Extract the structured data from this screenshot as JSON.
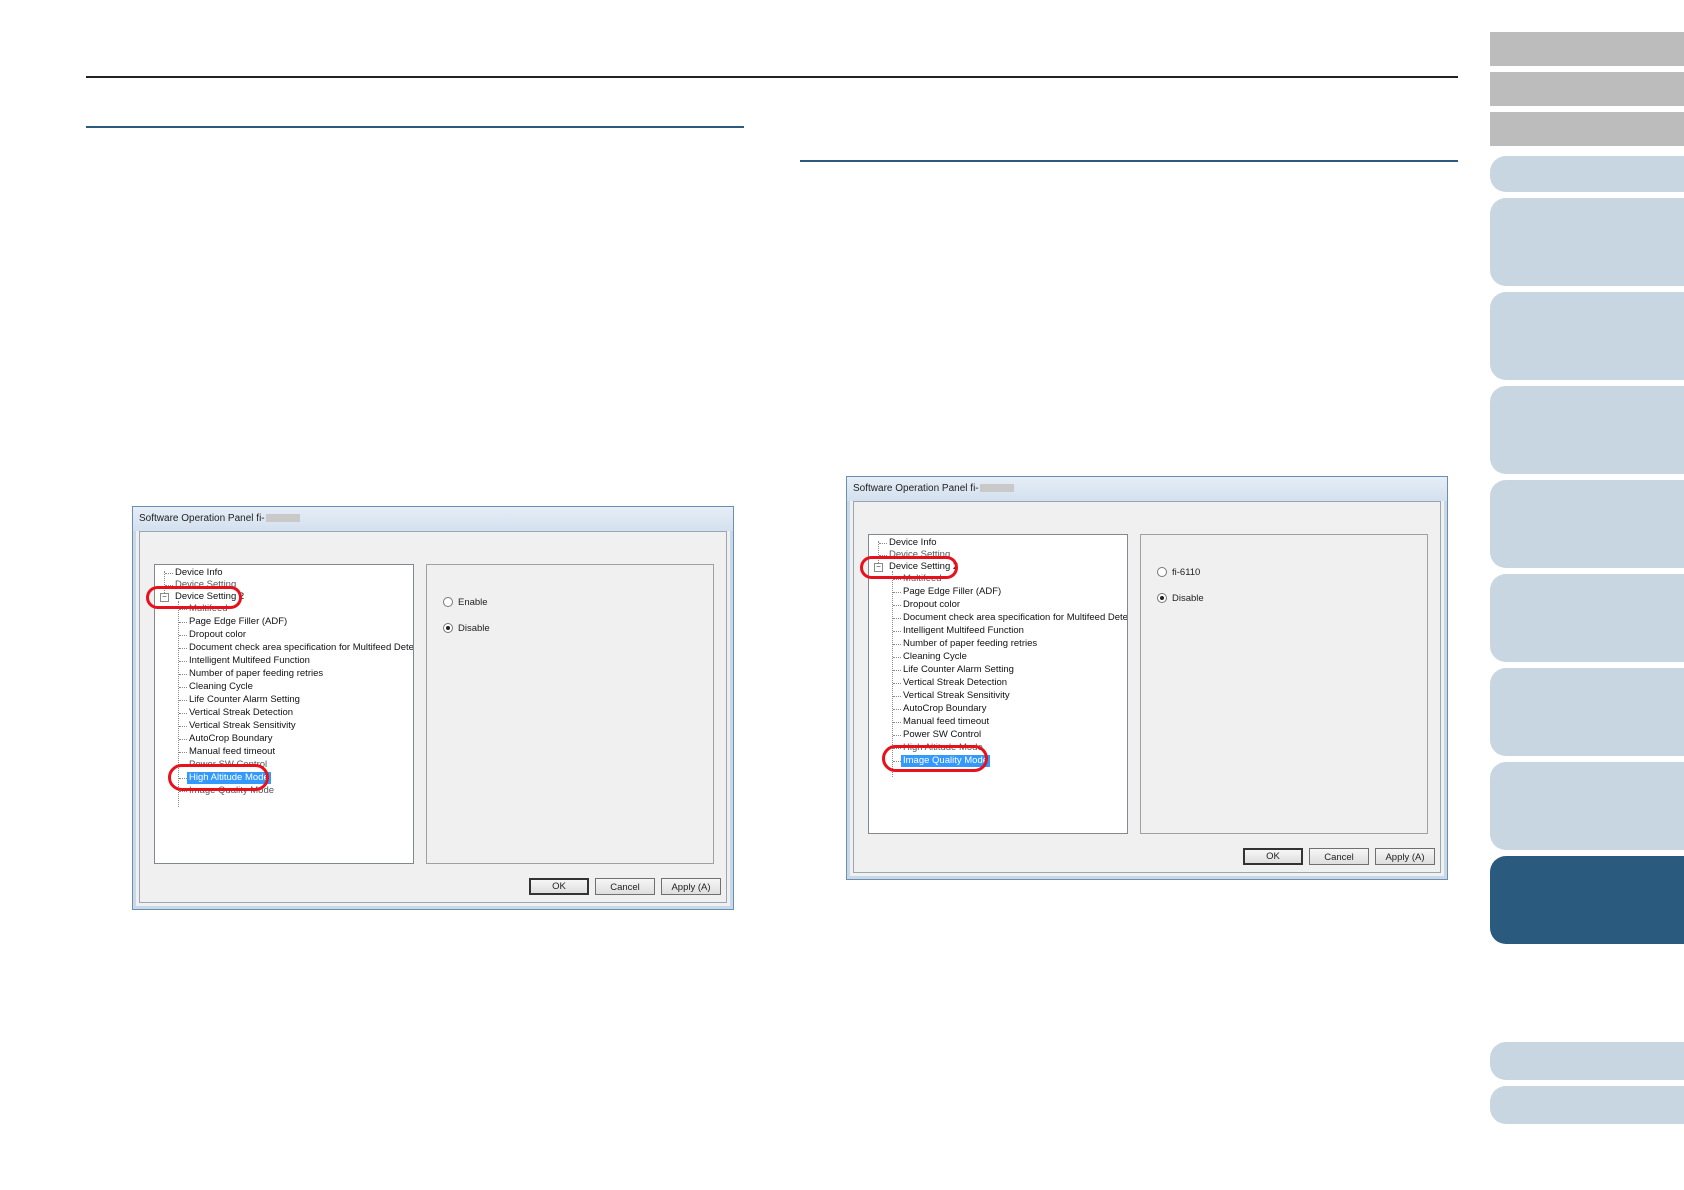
{
  "dialog_left": {
    "title": "Software Operation Panel fi-",
    "tree": [
      "Device Info",
      "Device Setting",
      "Device Setting 2",
      "Multifeed",
      "Page Edge Filler (ADF)",
      "Dropout color",
      "Document check area specification for Multifeed Detection",
      "Intelligent Multifeed Function",
      "Number of paper feeding retries",
      "Cleaning Cycle",
      "Life Counter Alarm Setting",
      "Vertical Streak Detection",
      "Vertical Streak Sensitivity",
      "AutoCrop Boundary",
      "Manual feed timeout",
      "Power SW Control",
      "High Altitude Mode",
      "Image Quality Mode"
    ],
    "selected": "High Altitude Mode",
    "options": [
      "Enable",
      "Disable"
    ],
    "selected_option": "Disable",
    "buttons": {
      "ok": "OK",
      "cancel": "Cancel",
      "apply": "Apply (A)"
    }
  },
  "dialog_right": {
    "title": "Software Operation Panel fi-",
    "tree": [
      "Device Info",
      "Device Setting",
      "Device Setting 2",
      "Multifeed",
      "Page Edge Filler (ADF)",
      "Dropout color",
      "Document check area specification for Multifeed Detection",
      "Intelligent Multifeed Function",
      "Number of paper feeding retries",
      "Cleaning Cycle",
      "Life Counter Alarm Setting",
      "Vertical Streak Detection",
      "Vertical Streak Sensitivity",
      "AutoCrop Boundary",
      "Manual feed timeout",
      "Power SW Control",
      "High Altitude Mode",
      "Image Quality Mode"
    ],
    "selected": "Image Quality Mode",
    "options": [
      "fi-6110",
      "Disable"
    ],
    "selected_option": "Disable",
    "buttons": {
      "ok": "OK",
      "cancel": "Cancel",
      "apply": "Apply (A)"
    }
  },
  "colors": {
    "section_rule": "#2c5a7d",
    "tab_gray": "#bcbcbc",
    "tab_light": "#c7d6e0",
    "tab_active": "#2a5b7e",
    "highlight_ring": "#e8101a",
    "tree_selection": "#3399ff"
  }
}
